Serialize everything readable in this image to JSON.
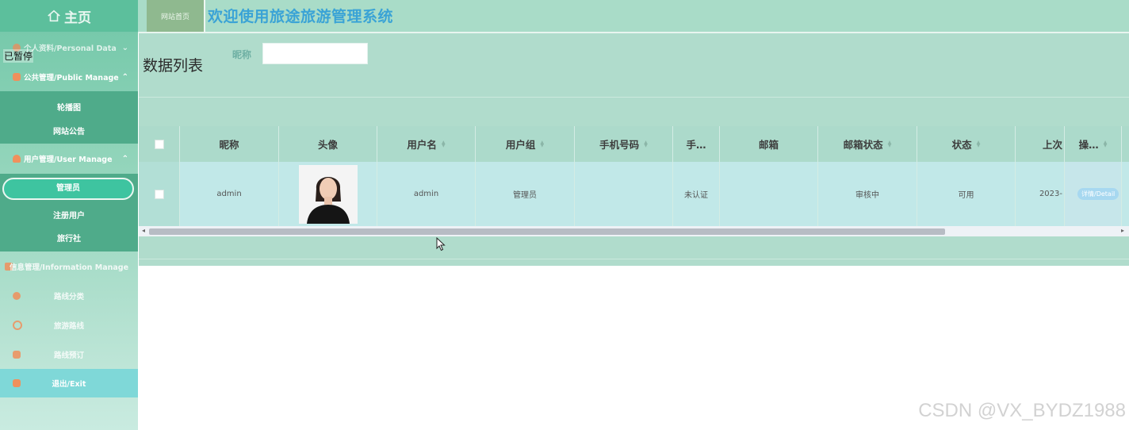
{
  "sidebar": {
    "home_label": "主页",
    "paused_label": "已暂停",
    "personal_data": "个人资料/Personal Data",
    "public_manage": "公共管理/Public Manage",
    "public_items": [
      "轮播图",
      "网站公告"
    ],
    "user_manage": "用户管理/User Manage",
    "user_items": [
      "管理员",
      "注册用户",
      "旅行社"
    ],
    "information_manage": "信息管理/Information Manage",
    "info_items": [
      "路线分类",
      "旅游路线",
      "路线预订"
    ],
    "exit_label": "退出/Exit"
  },
  "header": {
    "site_home_tab": "网站首页",
    "title": "欢迎使用旅途旅游管理系统"
  },
  "main": {
    "page_title": "数据列表",
    "filter_label": "昵称",
    "filter_value": "",
    "table": {
      "columns": [
        "",
        "昵称",
        "头像",
        "用户名",
        "用户组",
        "手机号码",
        "手…",
        "邮箱",
        "邮箱状态",
        "状态",
        "上次",
        "操…"
      ],
      "rows": [
        {
          "nickname": "admin",
          "username": "admin",
          "group": "管理员",
          "phone": "",
          "phone_status": "未认证",
          "email": "",
          "email_status": "审核中",
          "status": "可用",
          "last_login": "2023-",
          "action": "详情/Detail"
        }
      ]
    }
  },
  "watermark": "CSDN @VX_BYDZ1988",
  "colors": {
    "accent": "#3ec4a0",
    "title_blue": "#3aa3d6",
    "panel_bg": "#b0dccc"
  }
}
